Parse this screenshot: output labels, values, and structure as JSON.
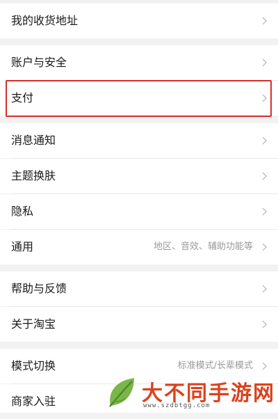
{
  "settings": {
    "items": [
      {
        "label": "我的收货地址",
        "sub": ""
      },
      {
        "label": "账户与安全",
        "sub": ""
      },
      {
        "label": "支付",
        "sub": ""
      },
      {
        "label": "消息通知",
        "sub": ""
      },
      {
        "label": "主题换肤",
        "sub": ""
      },
      {
        "label": "隐私",
        "sub": ""
      },
      {
        "label": "通用",
        "sub": "地区、音效、辅助功能等"
      },
      {
        "label": "帮助与反馈",
        "sub": ""
      },
      {
        "label": "关于淘宝",
        "sub": ""
      },
      {
        "label": "模式切换",
        "sub": "标准模式/长辈模式"
      },
      {
        "label": "商家入驻",
        "sub": ""
      }
    ]
  },
  "colors": {
    "highlight_border": "#d62c2c",
    "watermark_brand": "#d9431f"
  },
  "watermark": {
    "brand": "大不同手游网",
    "url": "www.szdbtgg.com",
    "icon": "leaf-logo-icon"
  }
}
